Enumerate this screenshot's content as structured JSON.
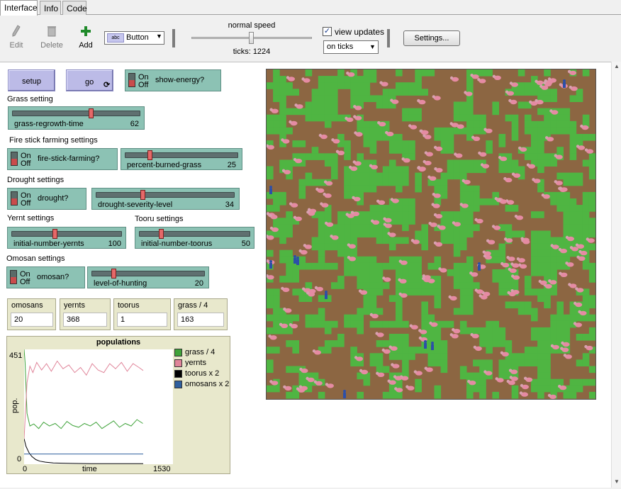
{
  "tabs": [
    {
      "label": "Interface",
      "active": true
    },
    {
      "label": "Info",
      "active": false
    },
    {
      "label": "Code",
      "active": false
    }
  ],
  "toolbar": {
    "edit_label": "Edit",
    "delete_label": "Delete",
    "add_label": "Add",
    "widget_type": "Button",
    "speed_label": "normal speed",
    "ticks_text": "ticks: 1224",
    "view_updates_label": "view updates",
    "view_updates_checked": true,
    "update_mode": "on ticks",
    "settings_label": "Settings..."
  },
  "buttons": {
    "setup": "setup",
    "go": "go"
  },
  "switch_text": {
    "on": "On",
    "off": "Off"
  },
  "switches": {
    "show_energy": {
      "label": "show-energy?",
      "state": "off"
    },
    "fire_stick": {
      "label": "fire-stick-farming?",
      "state": "off"
    },
    "drought": {
      "label": "drought?",
      "state": "off"
    },
    "omosan": {
      "label": "omosan?",
      "state": "off"
    }
  },
  "sections": {
    "grass": "Grass setting",
    "fire": "Fire stick farming settings",
    "drought": "Drought settings",
    "yernt": "Yernt settings",
    "tooru": "Tooru settings",
    "omosan": "Omosan settings"
  },
  "sliders": {
    "grass_regrowth": {
      "label": "grass-regrowth-time",
      "value": "62"
    },
    "percent_burned": {
      "label": "percent-burned-grass",
      "value": "25"
    },
    "drought_severity": {
      "label": "drought-severity-level",
      "value": "34"
    },
    "init_yernts": {
      "label": "initial-number-yernts",
      "value": "100"
    },
    "init_toorus": {
      "label": "initial-number-toorus",
      "value": "50"
    },
    "hunting": {
      "label": "level-of-hunting",
      "value": "20"
    }
  },
  "monitors": {
    "omosans": {
      "label": "omosans",
      "value": "20"
    },
    "yernts": {
      "label": "yernts",
      "value": "368"
    },
    "toorus": {
      "label": "toorus",
      "value": "1"
    },
    "grass": {
      "label": "grass / 4",
      "value": "163"
    }
  },
  "plot": {
    "title": "populations",
    "ylabel": "pop.",
    "xlabel": "time",
    "xmin": "0",
    "xmax": "1530",
    "ymin": "0",
    "ymax": "451"
  },
  "chart_data": {
    "type": "line",
    "title": "populations",
    "xlabel": "time",
    "ylabel": "pop.",
    "xlim": [
      0,
      1530
    ],
    "ylim": [
      0,
      451
    ],
    "legend_position": "right",
    "series": [
      {
        "name": "grass / 4",
        "color": "#3fa33a",
        "x": [
          0,
          10,
          30,
          60,
          100,
          150,
          200,
          260,
          320,
          380,
          440,
          500,
          560,
          620,
          680,
          740,
          800,
          860,
          920,
          980,
          1040,
          1100,
          1160,
          1220
        ],
        "y": [
          451,
          400,
          200,
          150,
          158,
          140,
          165,
          150,
          160,
          140,
          168,
          152,
          145,
          160,
          150,
          165,
          140,
          155,
          170,
          145,
          160,
          150,
          175,
          160
        ]
      },
      {
        "name": "yernts",
        "color": "#e0859a",
        "x": [
          0,
          30,
          60,
          90,
          130,
          180,
          230,
          280,
          340,
          400,
          460,
          520,
          580,
          640,
          700,
          760,
          820,
          880,
          940,
          1000,
          1060,
          1120,
          1180,
          1224
        ],
        "y": [
          100,
          320,
          385,
          360,
          400,
          370,
          395,
          365,
          405,
          375,
          390,
          360,
          380,
          350,
          395,
          370,
          360,
          395,
          375,
          400,
          365,
          395,
          380,
          368
        ]
      },
      {
        "name": "toorus x 2",
        "color": "#000000",
        "x": [
          0,
          20,
          50,
          80,
          120,
          160,
          220,
          300,
          400,
          500,
          700,
          900,
          1100,
          1224
        ],
        "y": [
          100,
          70,
          45,
          30,
          18,
          12,
          8,
          5,
          4,
          3,
          2,
          2,
          2,
          2
        ]
      },
      {
        "name": "omosans x 2",
        "color": "#2f5f9e",
        "x": [
          0,
          1224
        ],
        "y": [
          40,
          40
        ]
      }
    ]
  }
}
